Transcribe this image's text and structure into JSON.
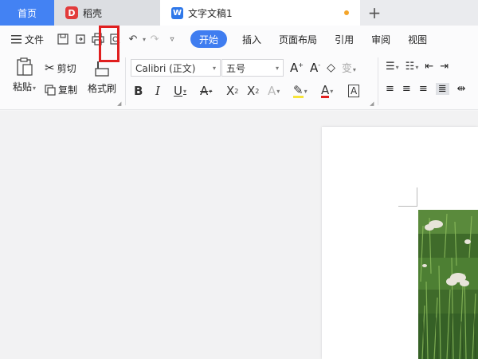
{
  "tabs": {
    "home": "首页",
    "daoke": "稻壳",
    "doc": "文字文稿1",
    "add": "+"
  },
  "menu": {
    "file": "文件",
    "tabs": [
      "开始",
      "插入",
      "页面布局",
      "引用",
      "审阅",
      "视图"
    ]
  },
  "clipboard": {
    "paste": "粘贴",
    "cut": "剪切",
    "copy": "复制",
    "format_painter": "格式刷"
  },
  "font": {
    "name": "Calibri (正文)",
    "size": "五号"
  },
  "icons": {
    "save": "save-icon",
    "export": "export-icon",
    "print": "print-icon",
    "preview": "print-preview-icon",
    "undo": "undo-icon",
    "redo": "redo-icon"
  },
  "colors": {
    "accent": "#3f7df0",
    "home_tab": "#4382f3",
    "highlight": "#e01f1f",
    "modified_dot": "#f4a52a"
  }
}
